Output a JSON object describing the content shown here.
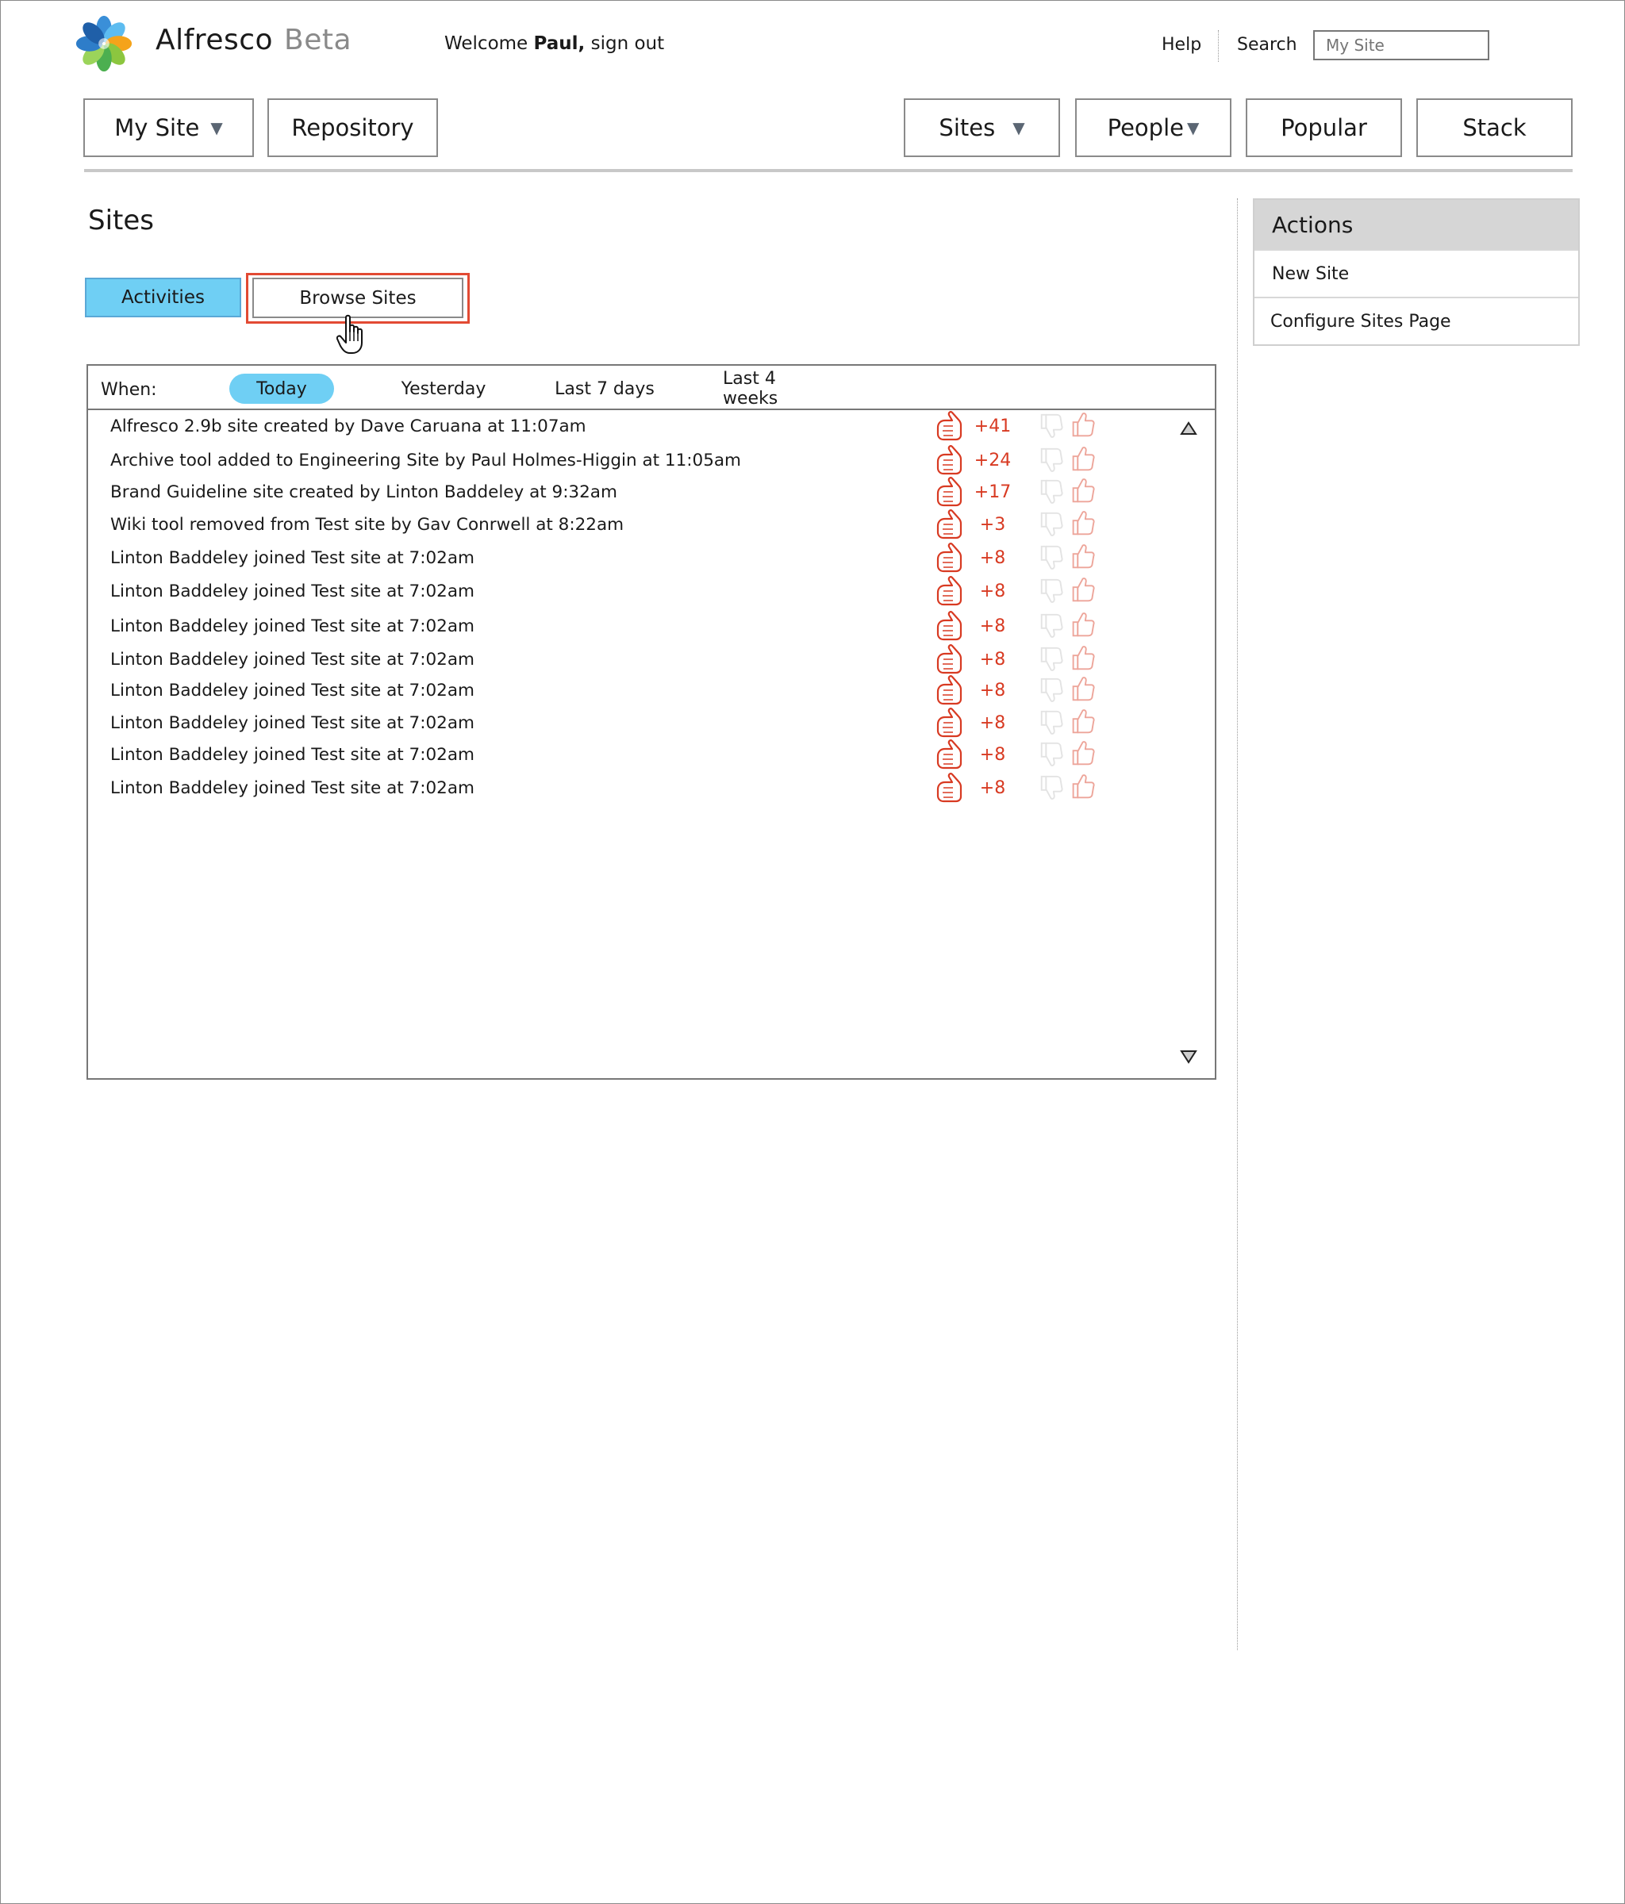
{
  "header": {
    "brand": "Alfresco",
    "brand_suffix": "Beta",
    "welcome_prefix": "Welcome",
    "user": "Paul,",
    "signout": "sign out",
    "help": "Help",
    "search_label": "Search",
    "search_placeholder": "My Site"
  },
  "nav": {
    "my_site": "My Site",
    "repository": "Repository",
    "sites": "Sites",
    "people": "People",
    "popular": "Popular",
    "stack": "Stack"
  },
  "page": {
    "title": "Sites",
    "tabs": {
      "activities": "Activities",
      "browse": "Browse Sites"
    }
  },
  "filter": {
    "when": "When:",
    "options": [
      "Today",
      "Yesterday",
      "Last 7 days",
      "Last 4 weeks"
    ],
    "selected": "Today"
  },
  "activities": [
    {
      "text": "Alfresco 2.9b site created by Dave Caruana at 11:07am",
      "score": "+41"
    },
    {
      "text": "Archive tool added to Engineering Site by Paul Holmes-Higgin at 11:05am",
      "score": "+24"
    },
    {
      "text": "Brand Guideline site created by Linton Baddeley at 9:32am",
      "score": "+17"
    },
    {
      "text": "Wiki tool removed from Test site by Gav Conrwell at 8:22am",
      "score": "+3"
    },
    {
      "text": "Linton Baddeley joined Test site at 7:02am",
      "score": "+8"
    },
    {
      "text": "Linton Baddeley joined Test site at 7:02am",
      "score": "+8"
    },
    {
      "text": "Linton Baddeley joined Test site at 7:02am",
      "score": "+8"
    },
    {
      "text": "Linton Baddeley joined Test site at 7:02am",
      "score": "+8"
    },
    {
      "text": "Linton Baddeley joined Test site at 7:02am",
      "score": "+8"
    },
    {
      "text": "Linton Baddeley joined Test site at 7:02am",
      "score": "+8"
    },
    {
      "text": "Linton Baddeley joined Test site at 7:02am",
      "score": "+8"
    },
    {
      "text": "Linton Baddeley joined Test site at 7:02am",
      "score": "+8"
    }
  ],
  "sidebar": {
    "title": "Actions",
    "items": [
      "New Site",
      "Configure Sites Page"
    ]
  },
  "colors": {
    "accent": "#6fcff4",
    "highlight": "#e24a33",
    "score": "#d83a22"
  },
  "icons": {
    "logo": "alfresco-flower-logo",
    "thumb": "hand-pointing-icon",
    "vote_down": "thumbs-down-icon",
    "vote_up": "thumbs-up-icon",
    "cursor": "hand-cursor-icon"
  }
}
